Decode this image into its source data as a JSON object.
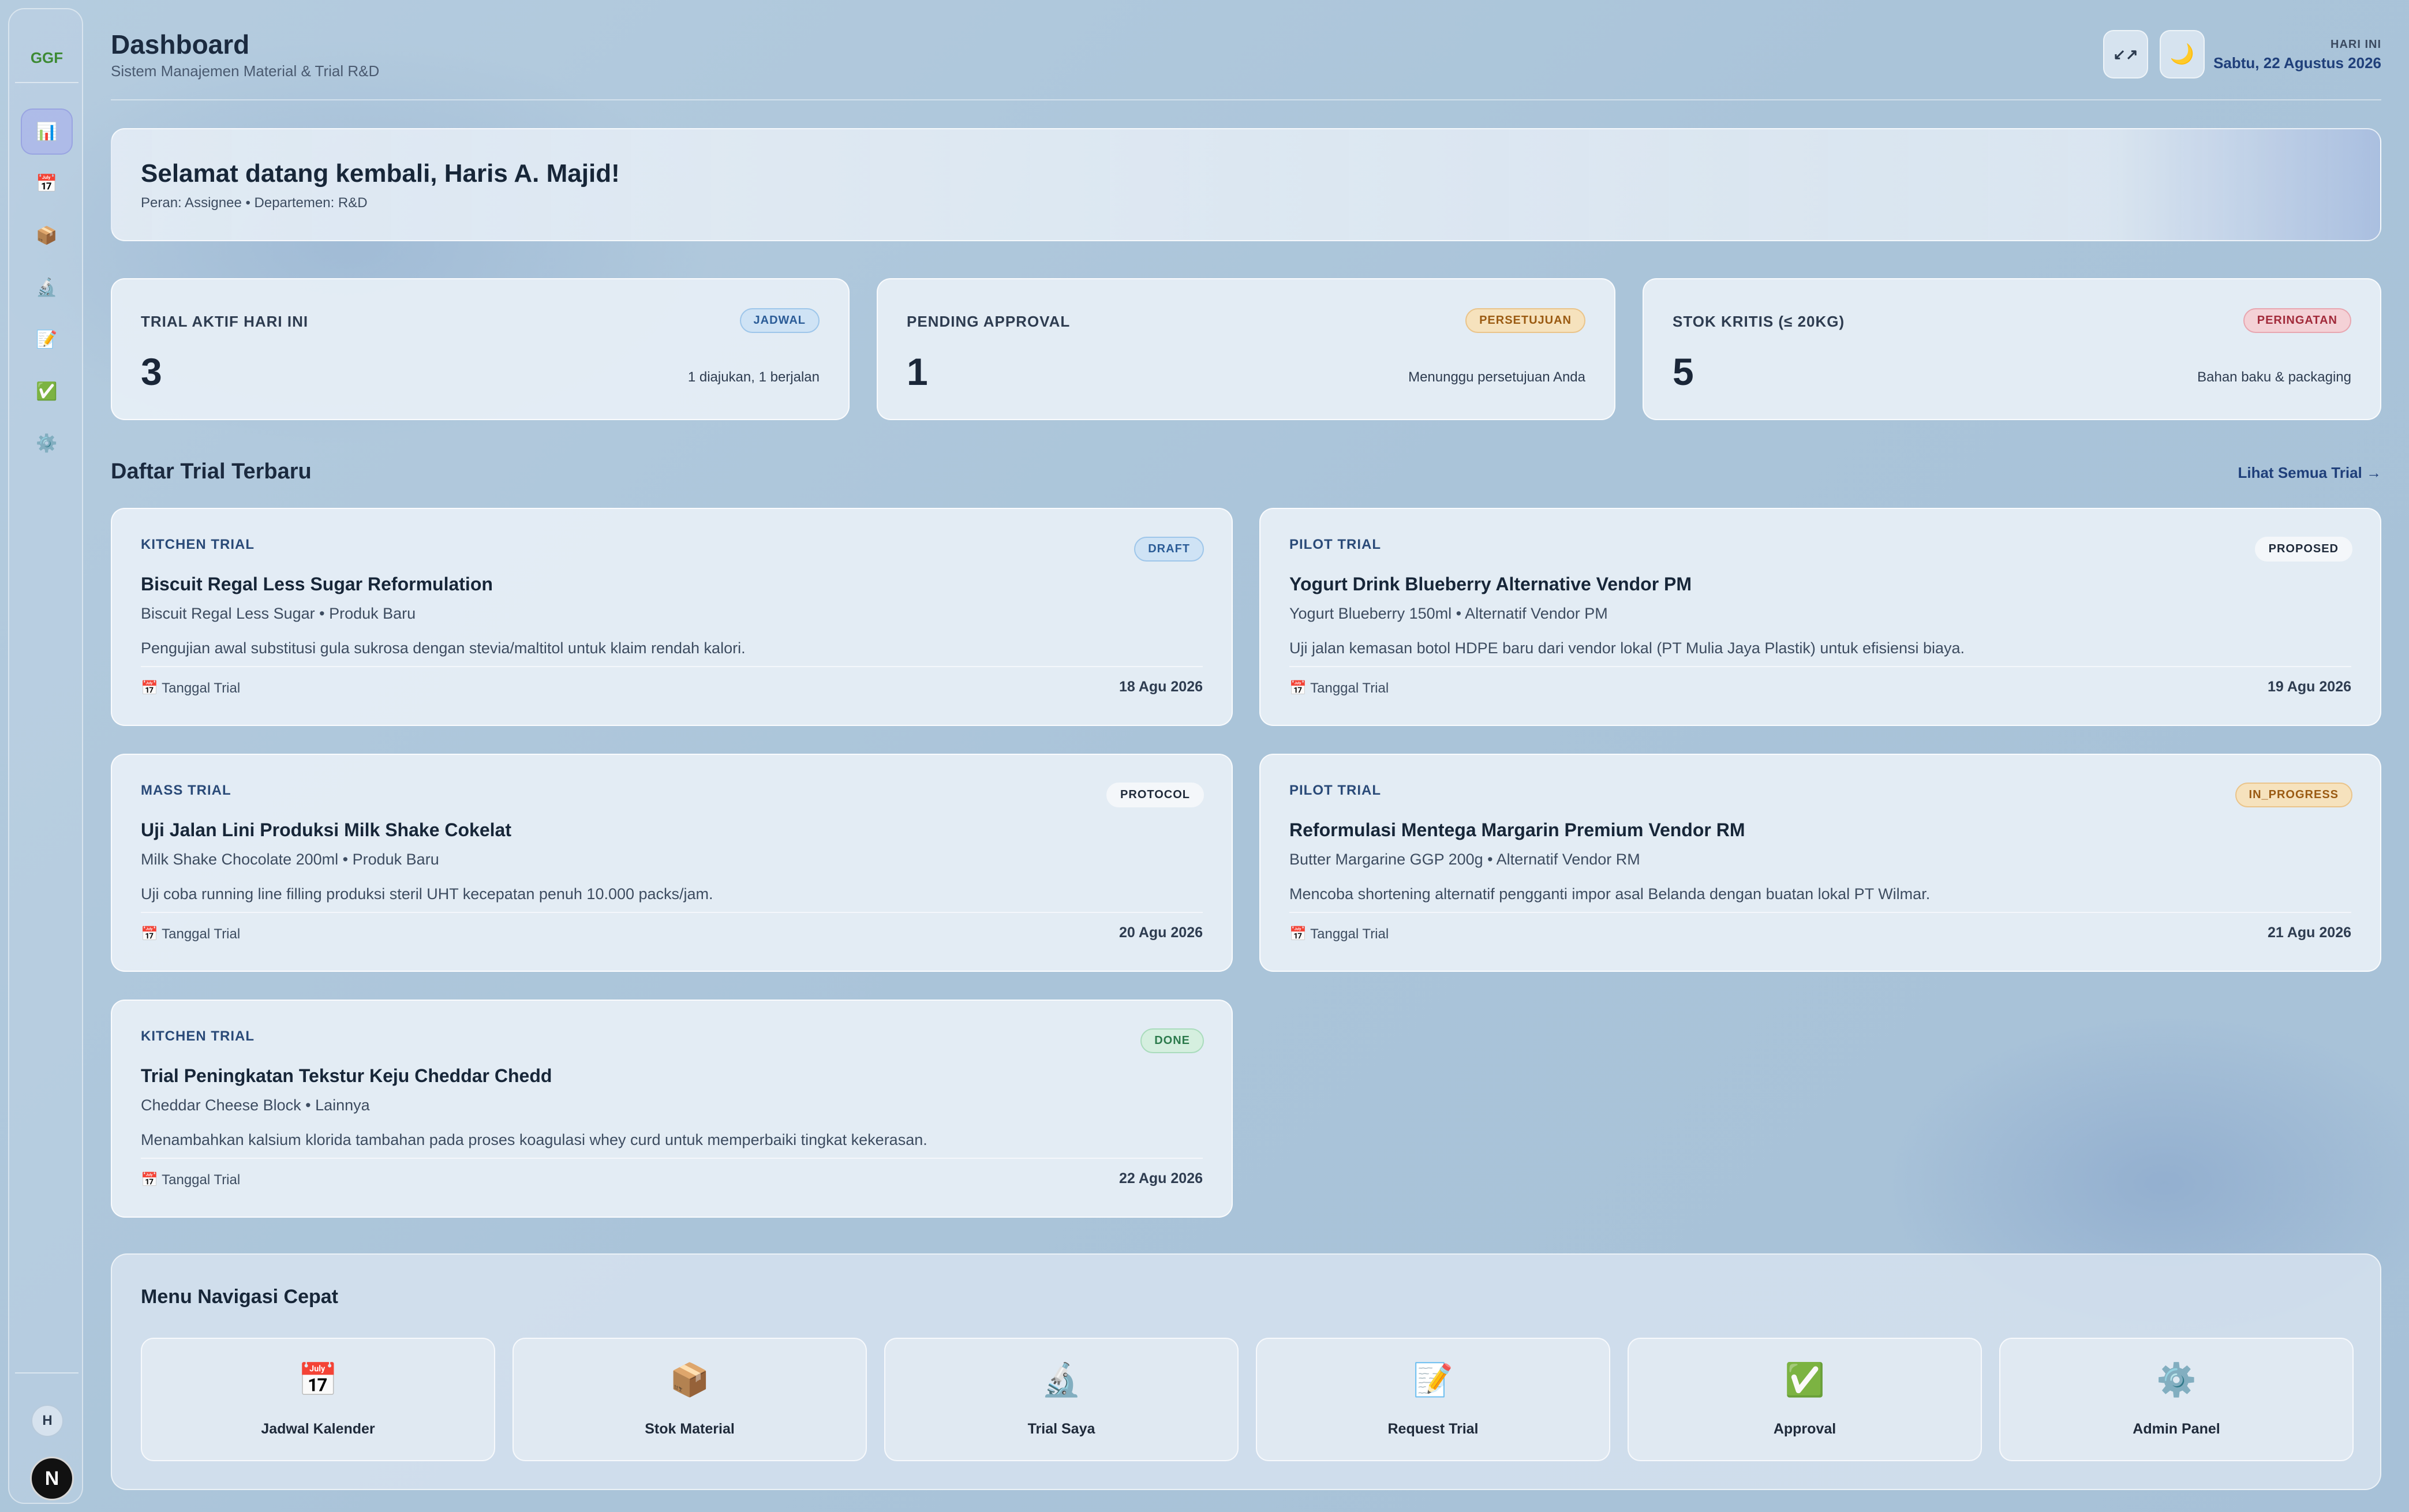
{
  "sidebar": {
    "logo": "GGF",
    "nav_icons": [
      "📊",
      "📅",
      "📦",
      "🔬",
      "📝",
      "✅",
      "⚙️"
    ],
    "avatar_initial": "H",
    "bottom_logo": "N"
  },
  "header": {
    "title": "Dashboard",
    "subtitle": "Sistem Manajemen Material & Trial R&D",
    "collapse_icon": "↙↗",
    "theme_icon": "🌙",
    "date_label": "HARI INI",
    "date": "Sabtu, 22 Agustus 2026"
  },
  "welcome": {
    "title": "Selamat datang kembali, Haris A. Majid!",
    "meta": "Peran: Assignee • Departemen: R&D"
  },
  "stats": [
    {
      "label": "TRIAL AKTIF HARI INI",
      "badge": "JADWAL",
      "value": "3",
      "note": "1 diajukan, 1 berjalan"
    },
    {
      "label": "PENDING APPROVAL",
      "badge": "PERSETUJUAN",
      "value": "1",
      "note": "Menunggu persetujuan Anda"
    },
    {
      "label": "STOK KRITIS (≤ 20KG)",
      "badge": "PERINGATAN",
      "value": "5",
      "note": "Bahan baku & packaging"
    }
  ],
  "trials_section": {
    "title": "Daftar Trial Terbaru",
    "link": "Lihat Semua Trial →"
  },
  "trials": [
    {
      "type": "KITCHEN TRIAL",
      "status": "DRAFT",
      "title": "Biscuit Regal Less Sugar Reformulation",
      "sub": "Biscuit Regal Less Sugar • Produk Baru",
      "desc": "Pengujian awal substitusi gula sukrosa dengan stevia/maltitol untuk klaim rendah kalori.",
      "date_label": "📅 Tanggal Trial",
      "date": "18 Agu 2026"
    },
    {
      "type": "PILOT TRIAL",
      "status": "PROPOSED",
      "title": "Yogurt Drink Blueberry Alternative Vendor PM",
      "sub": "Yogurt Blueberry 150ml • Alternatif Vendor PM",
      "desc": "Uji jalan kemasan botol HDPE baru dari vendor lokal (PT Mulia Jaya Plastik) untuk efisiensi biaya.",
      "date_label": "📅 Tanggal Trial",
      "date": "19 Agu 2026"
    },
    {
      "type": "MASS TRIAL",
      "status": "PROTOCOL",
      "title": "Uji Jalan Lini Produksi Milk Shake Cokelat",
      "sub": "Milk Shake Chocolate 200ml • Produk Baru",
      "desc": "Uji coba running line filling produksi steril UHT kecepatan penuh 10.000 packs/jam.",
      "date_label": "📅 Tanggal Trial",
      "date": "20 Agu 2026"
    },
    {
      "type": "PILOT TRIAL",
      "status": "IN_PROGRESS",
      "title": "Reformulasi Mentega Margarin Premium Vendor RM",
      "sub": "Butter Margarine GGP 200g • Alternatif Vendor RM",
      "desc": "Mencoba shortening alternatif pengganti impor asal Belanda dengan buatan lokal PT Wilmar.",
      "date_label": "📅 Tanggal Trial",
      "date": "21 Agu 2026"
    },
    {
      "type": "KITCHEN TRIAL",
      "status": "DONE",
      "title": "Trial Peningkatan Tekstur Keju Cheddar Chedd",
      "sub": "Cheddar Cheese Block • Lainnya",
      "desc": "Menambahkan kalsium klorida tambahan pada proses koagulasi whey curd untuk memperbaiki tingkat kekerasan.",
      "date_label": "📅 Tanggal Trial",
      "date": "22 Agu 2026"
    }
  ],
  "quick_menu": {
    "title": "Menu Navigasi Cepat",
    "items": [
      {
        "icon": "📅",
        "label": "Jadwal Kalender"
      },
      {
        "icon": "📦",
        "label": "Stok Material"
      },
      {
        "icon": "🔬",
        "label": "Trial Saya"
      },
      {
        "icon": "📝",
        "label": "Request Trial"
      },
      {
        "icon": "✅",
        "label": "Approval"
      },
      {
        "icon": "⚙️",
        "label": "Admin Panel"
      }
    ]
  },
  "colors": {
    "accent": "#1f3f7a",
    "status_draft": "#cfe3f5",
    "status_proposed": "#f4f7fa",
    "status_protocol": "#f4f7fa",
    "status_in_progress": "#f6e2bd",
    "status_done": "#d5efdf"
  }
}
